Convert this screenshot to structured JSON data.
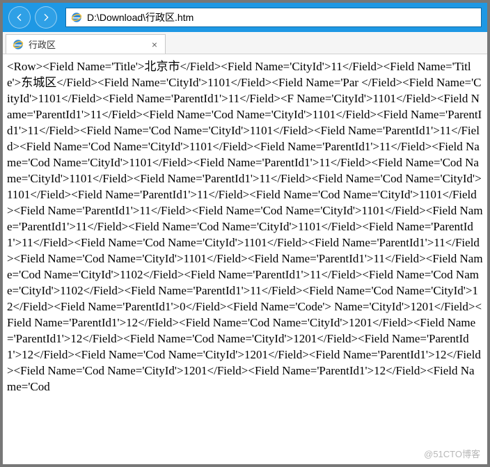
{
  "titlebar": {
    "address": "D:\\Download\\行政区.htm"
  },
  "tab": {
    "title": "行政区"
  },
  "watermark": "@51CTO博客",
  "content_lines": [
    "<Row><Field Name='Title'>北京市</Field><Field Name='CityId'>11</Field><Field Name='Title'>东城区</Field><Field Name='CityId'>1101</Field><Field Name='Par",
    "</Field><Field Name='CityId'>1101</Field><Field Name='ParentId1'>11</Field><F",
    "Name='CityId'>1101</Field><Field Name='ParentId1'>11</Field><Field Name='Cod",
    "Name='CityId'>1101</Field><Field Name='ParentId1'>11</Field><Field Name='Cod",
    "Name='CityId'>1101</Field><Field Name='ParentId1'>11</Field><Field Name='Cod",
    "Name='CityId'>1101</Field><Field Name='ParentId1'>11</Field><Field Name='Cod",
    "Name='CityId'>1101</Field><Field Name='ParentId1'>11</Field><Field Name='Cod",
    "Name='CityId'>1101</Field><Field Name='ParentId1'>11</Field><Field Name='Cod",
    "Name='CityId'>1101</Field><Field Name='ParentId1'>11</Field><Field Name='Cod",
    "Name='CityId'>1101</Field><Field Name='ParentId1'>11</Field><Field Name='Cod",
    "Name='CityId'>1101</Field><Field Name='ParentId1'>11</Field><Field Name='Cod",
    "Name='CityId'>1101</Field><Field Name='ParentId1'>11</Field><Field Name='Cod",
    "Name='CityId'>1101</Field><Field Name='ParentId1'>11</Field><Field Name='Cod",
    "Name='CityId'>1101</Field><Field Name='ParentId1'>11</Field><Field Name='Cod",
    "Name='CityId'>1102</Field><Field Name='ParentId1'>11</Field><Field Name='Cod",
    "Name='CityId'>1102</Field><Field Name='ParentId1'>11</Field><Field Name='Cod",
    "Name='CityId'>12</Field><Field Name='ParentId1'>0</Field><Field Name='Code'>",
    "Name='CityId'>1201</Field><Field Name='ParentId1'>12</Field><Field Name='Cod",
    "Name='CityId'>1201</Field><Field Name='ParentId1'>12</Field><Field Name='Cod",
    "Name='CityId'>1201</Field><Field Name='ParentId1'>12</Field><Field Name='Cod",
    "Name='CityId'>1201</Field><Field Name='ParentId1'>12</Field><Field Name='Cod",
    "Name='CityId'>1201</Field><Field Name='ParentId1'>12</Field><Field Name='Cod"
  ]
}
